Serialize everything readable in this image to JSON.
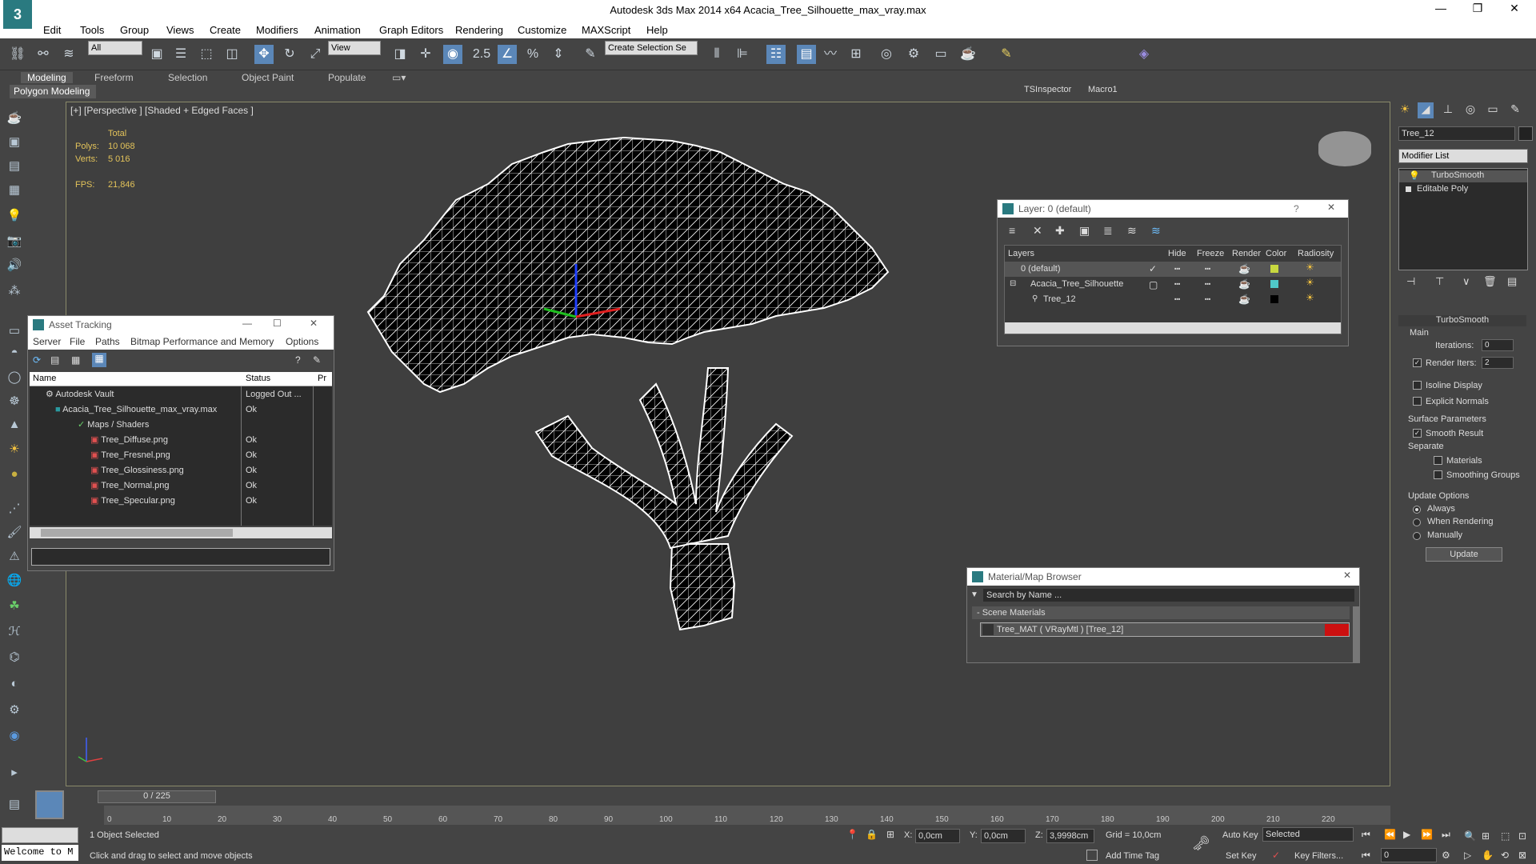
{
  "window": {
    "title": "Autodesk 3ds Max  2014 x64     Acacia_Tree_Silhouette_max_vray.max",
    "logo_text": "3",
    "minimize": "—",
    "restore": "❐",
    "close": "✕"
  },
  "menu": [
    "Edit",
    "Tools",
    "Group",
    "Views",
    "Create",
    "Modifiers",
    "Animation",
    "Graph Editors",
    "Rendering",
    "Customize",
    "MAXScript",
    "Help"
  ],
  "toolbar": {
    "selection_filter": "All",
    "ref_coord": "View",
    "named_selection": "Create Selection Se",
    "snap_value": "2.5",
    "tsinspector": "TSInspector",
    "macro": "Macro1"
  },
  "ribbon": {
    "tabs": [
      "Modeling",
      "Freeform",
      "Selection",
      "Object Paint",
      "Populate"
    ],
    "active": "Modeling",
    "panel": "Polygon Modeling"
  },
  "viewport": {
    "label": "[+] [Perspective ] [Shaded + Edged Faces ]",
    "stats": {
      "total_label": "Total",
      "polys_label": "Polys:",
      "polys": "10 068",
      "verts_label": "Verts:",
      "verts": "5 016",
      "fps_label": "FPS:",
      "fps": "21,846"
    }
  },
  "asset_tracking": {
    "title": "Asset Tracking",
    "menu": [
      "Server",
      "File",
      "Paths",
      "Bitmap Performance and Memory",
      "Options"
    ],
    "columns": [
      "Name",
      "Status",
      "Pr"
    ],
    "rows": [
      {
        "name": "Autodesk Vault",
        "status": "Logged Out ..."
      },
      {
        "name": "Acacia_Tree_Silhouette_max_vray.max",
        "status": "Ok"
      },
      {
        "name": "Maps / Shaders",
        "status": ""
      },
      {
        "name": "Tree_Diffuse.png",
        "status": "Ok"
      },
      {
        "name": "Tree_Fresnel.png",
        "status": "Ok"
      },
      {
        "name": "Tree_Glossiness.png",
        "status": "Ok"
      },
      {
        "name": "Tree_Normal.png",
        "status": "Ok"
      },
      {
        "name": "Tree_Specular.png",
        "status": "Ok"
      }
    ]
  },
  "layer_window": {
    "title": "Layer: 0 (default)",
    "help": "?",
    "columns": [
      "Layers",
      "Hide",
      "Freeze",
      "Render",
      "Color",
      "Radiosity"
    ],
    "rows": [
      {
        "name": "0 (default)",
        "color": "#c8d840"
      },
      {
        "name": "Acacia_Tree_Silhouette",
        "color": "#50c8c8"
      },
      {
        "name": "Tree_12",
        "color": "#000000"
      }
    ]
  },
  "material_browser": {
    "title": "Material/Map Browser",
    "search_placeholder": "Search by Name ...",
    "section": "- Scene Materials",
    "item": "Tree_MAT  ( VRayMtl )  [Tree_12]",
    "swatch_color": "#cc1010"
  },
  "command_panel": {
    "object_name": "Tree_12",
    "modifier_list": "Modifier List",
    "stack": [
      "TurboSmooth",
      "Editable Poly"
    ],
    "rollout_title": "TurboSmooth",
    "main_label": "Main",
    "iterations_label": "Iterations:",
    "iterations": "0",
    "render_iters_label": "Render Iters:",
    "render_iters": "2",
    "isoline_label": "Isoline Display",
    "explicit_label": "Explicit Normals",
    "surface_label": "Surface Parameters",
    "smooth_label": "Smooth Result",
    "separate_label": "Separate",
    "materials_label": "Materials",
    "smoothing_groups_label": "Smoothing Groups",
    "update_options_label": "Update Options",
    "always_label": "Always",
    "when_rendering_label": "When Rendering",
    "manually_label": "Manually",
    "update_button": "Update"
  },
  "timeline": {
    "frame": "0 / 225",
    "ticks": [
      "0",
      "10",
      "20",
      "30",
      "40",
      "50",
      "60",
      "70",
      "80",
      "90",
      "100",
      "110",
      "120",
      "130",
      "140",
      "150",
      "160",
      "170",
      "180",
      "190",
      "200",
      "210",
      "220"
    ]
  },
  "status": {
    "maxscript": "Welcome to M",
    "selected": "1 Object Selected",
    "prompt": "Click and drag to select and move objects",
    "x_label": "X:",
    "x": "0,0cm",
    "y_label": "Y:",
    "y": "0,0cm",
    "z_label": "Z:",
    "z": "3,9998cm",
    "grid": "Grid = 10,0cm",
    "add_time_tag": "Add Time Tag",
    "auto_key": "Auto Key",
    "set_key": "Set Key",
    "selected_dropdown": "Selected",
    "key_filters": "Key Filters...",
    "frame_field": "0"
  }
}
